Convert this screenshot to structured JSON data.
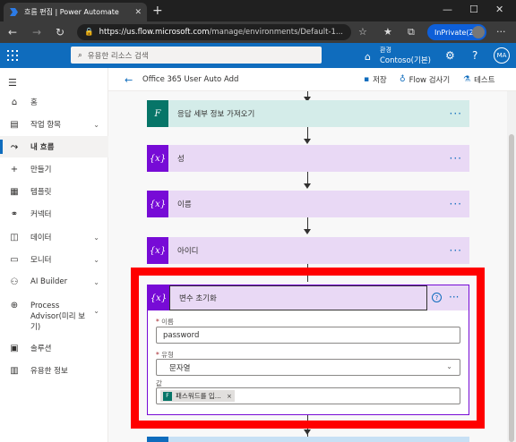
{
  "browser": {
    "tab_title": "흐름 편집 | Power Automate",
    "tab_close": "✕",
    "new_tab": "+",
    "url_host": "https://us.flow.microsoft.com",
    "url_path": "/manage/environments/Default-1...",
    "inprivate_label": "InPrivate(2)"
  },
  "header": {
    "search_placeholder": "유용한 리소스 검색",
    "env_label": "환경",
    "env_name": "Contoso(기본)",
    "avatar_initials": "MA"
  },
  "leftnav": {
    "items": [
      {
        "label": "홈",
        "icon": "home-icon"
      },
      {
        "label": "작업 항목",
        "icon": "clipboard-icon",
        "expandable": true
      },
      {
        "label": "내 흐름",
        "icon": "flow-icon",
        "active": true
      },
      {
        "label": "만들기",
        "icon": "plus-icon"
      },
      {
        "label": "템플릿",
        "icon": "template-icon"
      },
      {
        "label": "커넥터",
        "icon": "connector-icon"
      },
      {
        "label": "데이터",
        "icon": "database-icon",
        "expandable": true
      },
      {
        "label": "모니터",
        "icon": "monitor-icon",
        "expandable": true
      },
      {
        "label": "AI Builder",
        "icon": "ai-builder-icon",
        "expandable": true
      },
      {
        "label": "Process Advisor(미리 보기)",
        "icon": "process-advisor-icon",
        "expandable": true
      },
      {
        "label": "솔루션",
        "icon": "solution-icon"
      },
      {
        "label": "유용한 정보",
        "icon": "book-icon"
      }
    ]
  },
  "cmdbar": {
    "flow_name": "Office 365 User Auto Add",
    "save_label": "저장",
    "checker_label": "Flow 검사기",
    "test_label": "테스트"
  },
  "flow": {
    "steps": [
      {
        "label": "응답 세부 정보 가져오기",
        "kind": "forms"
      },
      {
        "label": "성",
        "kind": "variable"
      },
      {
        "label": "이름",
        "kind": "variable"
      },
      {
        "label": "아이디",
        "kind": "variable"
      }
    ],
    "expanded_step": {
      "title": "변수 초기화",
      "name_label": "이름",
      "name_value": "password",
      "type_label": "유형",
      "type_value": "문자열",
      "value_label": "값",
      "token_label": "패스워드를 입...",
      "token_remove": "×"
    },
    "variable_icon_text": "{x}",
    "more_text": "···",
    "help_text": "?"
  },
  "colors": {
    "header_blue": "#0f6cbd",
    "variable_purple": "#770bd6",
    "forms_teal": "#077568",
    "highlight_red": "#ff0000"
  }
}
